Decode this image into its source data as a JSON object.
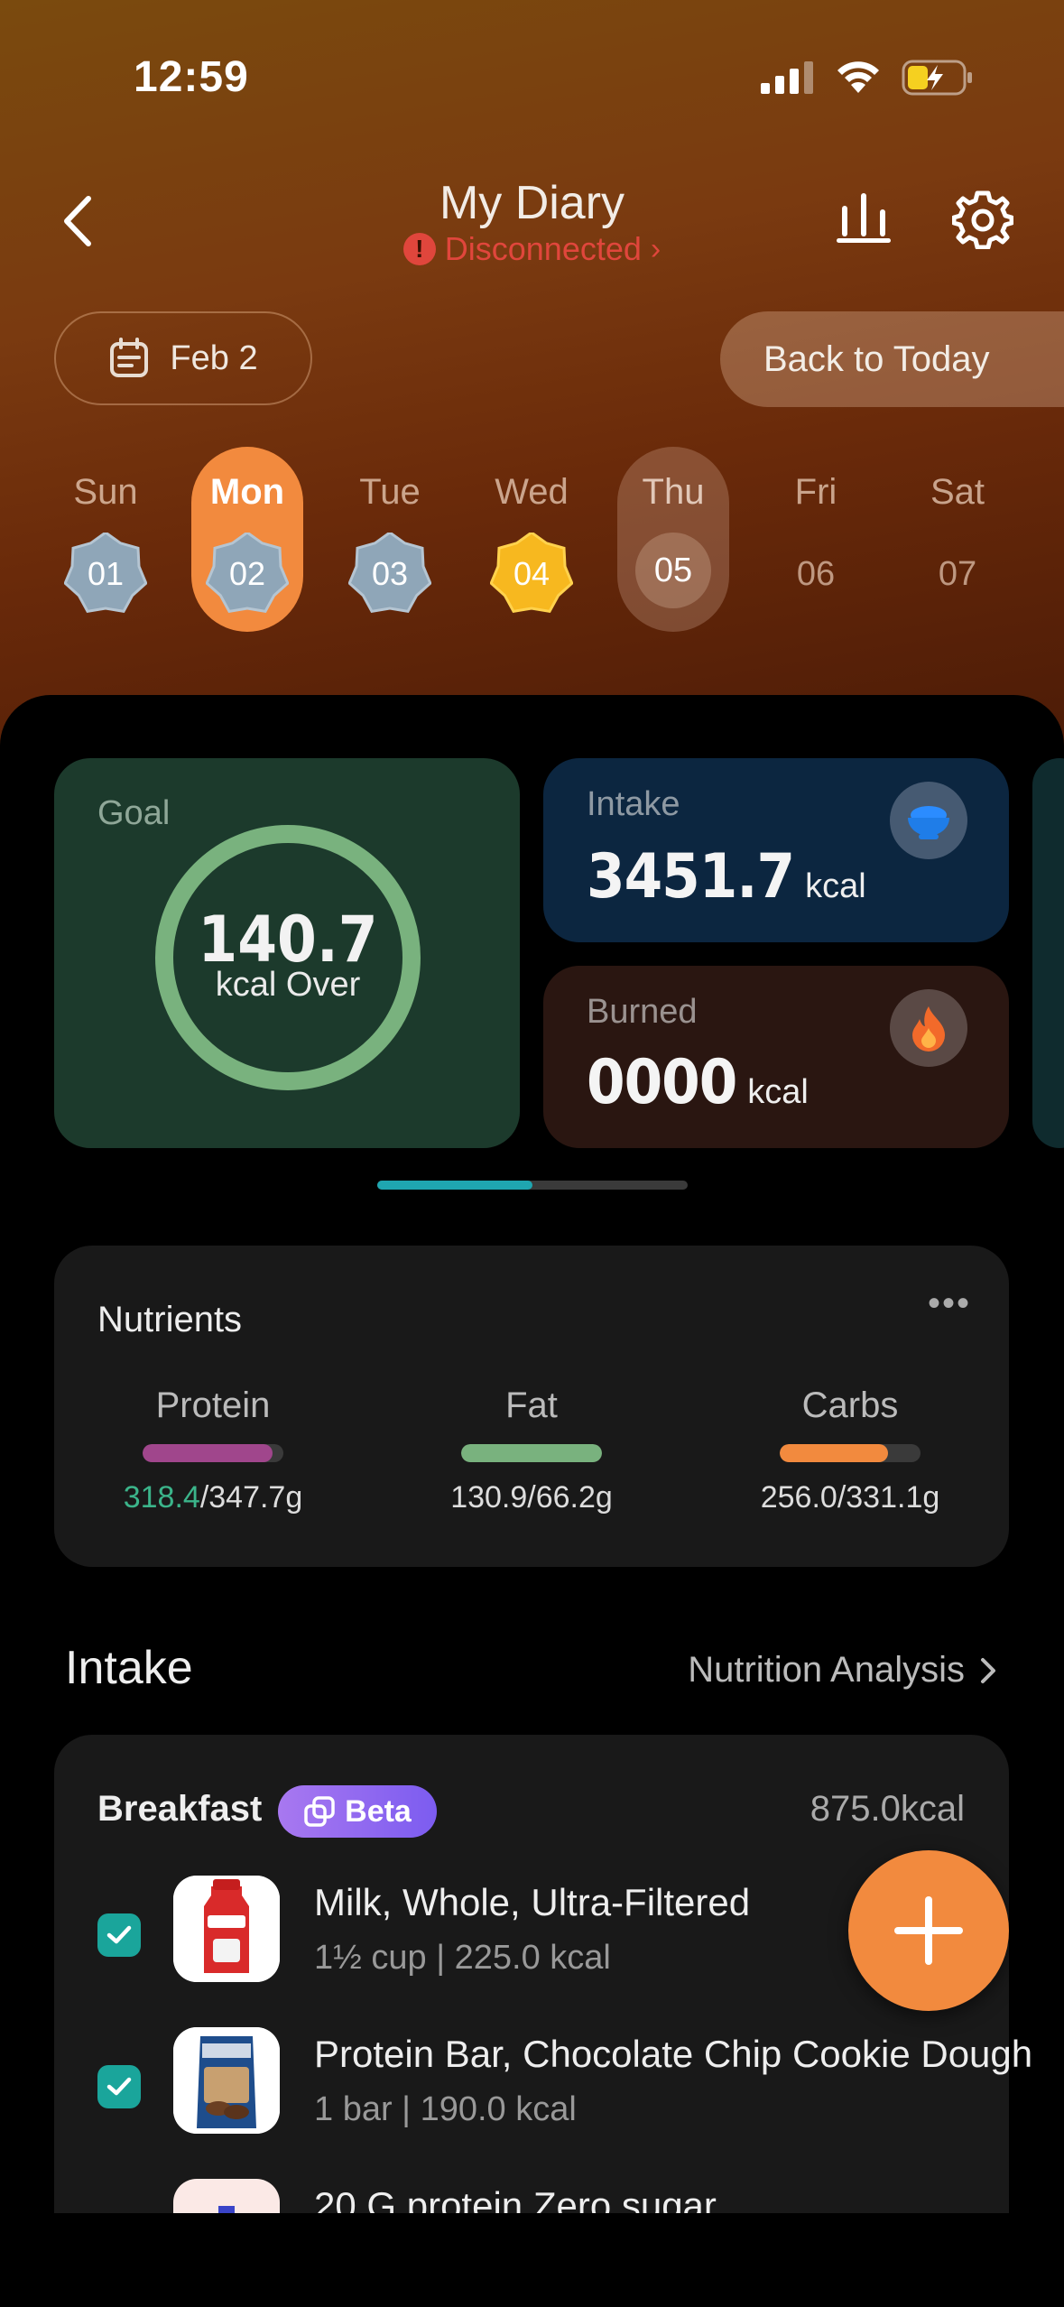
{
  "status_bar": {
    "time": "12:59"
  },
  "header": {
    "title": "My Diary",
    "connection_status": "Disconnected",
    "date_label": "Feb 2",
    "back_to_today": "Back to Today"
  },
  "week": [
    {
      "name": "Sun",
      "date": "01",
      "state": "badge-blue"
    },
    {
      "name": "Mon",
      "date": "02",
      "state": "selected"
    },
    {
      "name": "Tue",
      "date": "03",
      "state": "badge-blue"
    },
    {
      "name": "Wed",
      "date": "04",
      "state": "badge-gold"
    },
    {
      "name": "Thu",
      "date": "05",
      "state": "today"
    },
    {
      "name": "Fri",
      "date": "06",
      "state": "plain"
    },
    {
      "name": "Sat",
      "date": "07",
      "state": "plain"
    }
  ],
  "summary": {
    "goal_label": "Goal",
    "goal_value": "140.7",
    "goal_sub": "kcal Over",
    "intake_label": "Intake",
    "intake_value": "3451.7",
    "burned_label": "Burned",
    "burned_value": "0000",
    "unit": "kcal",
    "pager_progress": 0.5
  },
  "nutrients": {
    "title": "Nutrients",
    "items": [
      {
        "label": "Protein",
        "current": "318.4",
        "target": "/347.7g",
        "fill": 0.92,
        "color": "#a0468c"
      },
      {
        "label": "Fat",
        "value": "130.9/66.2g",
        "fill": 1.0,
        "color": "#79b27e"
      },
      {
        "label": "Carbs",
        "value": "256.0/331.1g",
        "fill": 0.77,
        "color": "#f28a3e"
      }
    ]
  },
  "intake": {
    "title": "Intake",
    "analysis_link": "Nutrition Analysis",
    "meal": {
      "title": "Breakfast",
      "badge": "Beta",
      "kcal": "875.0kcal",
      "foods": [
        {
          "name": "Milk, Whole, Ultra-Filtered",
          "detail": "1½ cup | 225.0 kcal"
        },
        {
          "name": "Protein Bar, Chocolate Chip Cookie Dough",
          "detail": "1 bar | 190.0 kcal"
        },
        {
          "name": "20 G protein Zero  sugar",
          "detail": ""
        }
      ]
    }
  },
  "colors": {
    "accent": "#f28a3e",
    "goal_ring": "#79b27e",
    "check": "#1aa59b",
    "warning": "#e0463c"
  }
}
